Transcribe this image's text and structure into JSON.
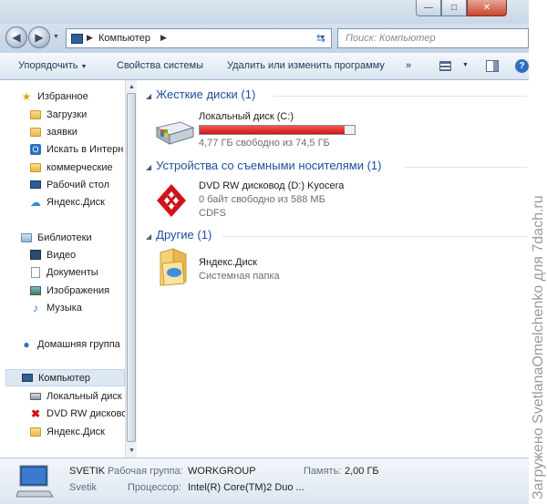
{
  "window": {
    "minimize": "—",
    "maximize": "□",
    "close": "✕"
  },
  "address": {
    "crumb": "Компьютер",
    "search_placeholder": "Поиск: Компьютер"
  },
  "toolbar": {
    "organize": "Упорядочить",
    "system_properties": "Свойства системы",
    "uninstall": "Удалить или изменить программу",
    "more": "»"
  },
  "sidebar": {
    "favorites": "Избранное",
    "fav_items": [
      "Загрузки",
      "заявки",
      "Искать в Интерн",
      "коммерческие",
      "Рабочий стол",
      "Яндекс.Диск"
    ],
    "libraries": "Библиотеки",
    "lib_items": [
      "Видео",
      "Документы",
      "Изображения",
      "Музыка"
    ],
    "homegroup": "Домашняя группа",
    "computer": "Компьютер",
    "comp_items": [
      "Локальный диск",
      "DVD RW дисково",
      "Яндекс.Диск"
    ]
  },
  "content": {
    "hdd_group": "Жесткие диски (1)",
    "hdd_name": "Локальный диск (C:)",
    "hdd_free": "4,77 ГБ свободно из 74,5 ГБ",
    "hdd_used_fraction": 0.936,
    "removable_group": "Устройства со съемными носителями (1)",
    "dvd_name": "DVD RW дисковод (D:) Kyocera",
    "dvd_free": "0 байт свободно из 588 МБ",
    "dvd_fs": "CDFS",
    "other_group": "Другие (1)",
    "yadisk_name": "Яндекс.Диск",
    "yadisk_type": "Системная папка"
  },
  "details": {
    "name": "SVETIK",
    "user": "Svetik",
    "workgroup_label": "Рабочая группа:",
    "workgroup": "WORKGROUP",
    "memory_label": "Память:",
    "memory": "2,00 ГБ",
    "cpu_label": "Процессор:",
    "cpu": "Intel(R) Core(TM)2 Duo ..."
  },
  "watermark": "Загружено SvetlanaOmelchenko для 7dach.ru"
}
